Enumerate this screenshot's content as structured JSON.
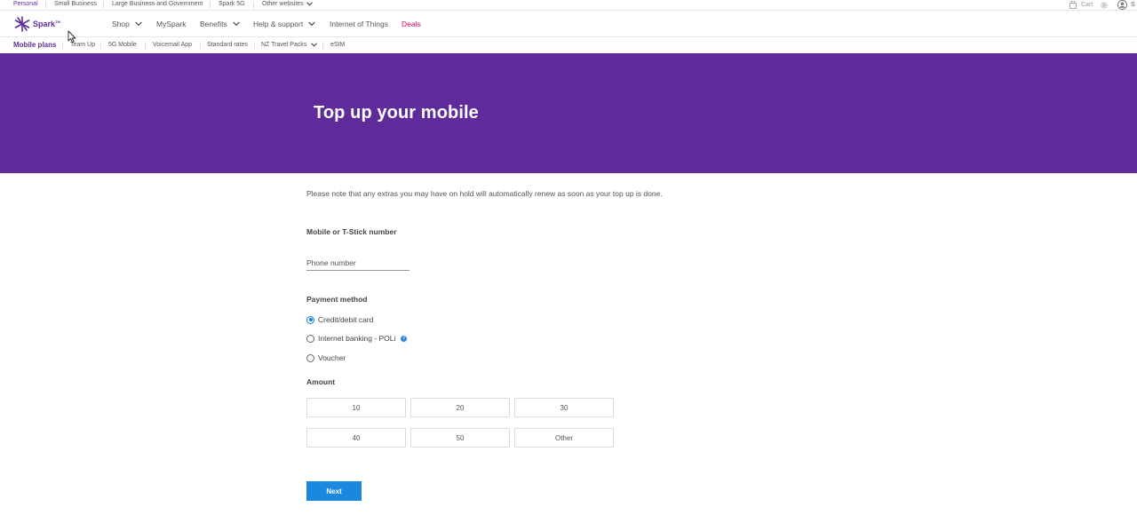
{
  "utility_bar": {
    "links": [
      "Personal",
      "Small Business",
      "Large Business and Government",
      "Spark 5G",
      "Other websites"
    ],
    "cart_label": "Cart",
    "signin_label": "S"
  },
  "main_nav": {
    "logo_text": "Spark",
    "logo_tm": "TM",
    "items": [
      "Shop",
      "MySpark",
      "Benefits",
      "Help & support",
      "Internet of Things",
      "Deals"
    ]
  },
  "sub_nav": {
    "items": [
      "Mobile plans",
      "Team Up",
      "5G Mobile",
      "Voicemail App",
      "Standard rates",
      "NZ Travel Packs",
      "eSIM"
    ]
  },
  "hero": {
    "title": "Top up your mobile"
  },
  "form": {
    "note": "Please note that any extras you may have on hold will automatically renew as soon as your top up is done.",
    "number_label": "Mobile or T-Stick number",
    "phone_placeholder": "Phone number",
    "payment_label": "Payment method",
    "payment_options": [
      "Credit/debit card",
      "Internet banking - POLi",
      "Voucher"
    ],
    "payment_selected": "Credit/debit card",
    "amount_label": "Amount",
    "amounts": [
      "10",
      "20",
      "30",
      "40",
      "50",
      "Other"
    ],
    "next_label": "Next"
  },
  "colors": {
    "brand_purple": "#5f2b9a",
    "deals_pink": "#e2006a",
    "button_blue": "#1a88dd"
  }
}
